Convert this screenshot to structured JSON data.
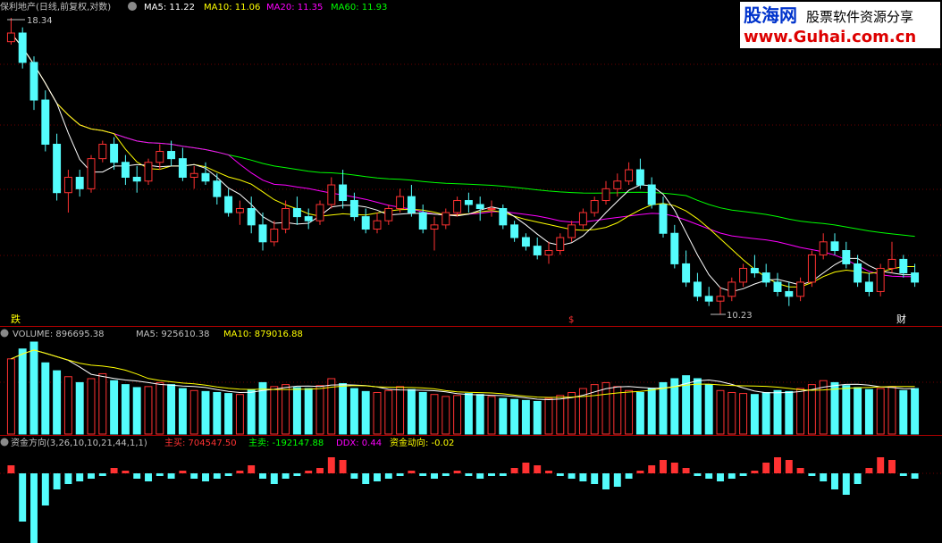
{
  "header": {
    "title": "保利地产(日线,前复权,对数)",
    "ma5": "MA5: 11.22",
    "ma10": "MA10: 11.06",
    "ma20": "MA20: 11.35",
    "ma60": "MA60: 11.93"
  },
  "price_panel": {
    "high_label": "18.34",
    "low_label": "10.23",
    "marker_left": "跌",
    "marker_mid": "$",
    "marker_right": "财"
  },
  "volume_panel": {
    "header": "VOLUME: 896695.38",
    "ma5": "MA5: 925610.38",
    "ma10": "MA10: 879016.88"
  },
  "fund_panel": {
    "title": "资金方向(3,26,10,10,21,44,1,1)",
    "main_buy": "主买: 704547.50",
    "main_sell": "主卖: -192147.88",
    "ddx": "DDX: 0.44",
    "flow": "资金动向: -0.02"
  },
  "logo": {
    "name": "股海网",
    "slogan": "股票软件资源分享",
    "url": "www.Guhai.com.cn"
  },
  "colors": {
    "up": "#ff3232",
    "down": "#54fcfc",
    "ma5": "#ffffff",
    "ma10": "#ffff00",
    "ma20": "#ff00ff",
    "ma60": "#00ff00",
    "background": "#000000",
    "grid": "#8b0000"
  },
  "chart_data": {
    "type": "candlestick",
    "title": "保利地产(日线,前复权,对数)",
    "y_high": 18.34,
    "y_low": 10.23,
    "ohlc": [
      [
        17.5,
        18.34,
        17.4,
        17.8
      ],
      [
        17.8,
        18.0,
        16.6,
        16.8
      ],
      [
        16.8,
        17.0,
        15.3,
        15.6
      ],
      [
        15.6,
        15.9,
        14.1,
        14.3
      ],
      [
        14.3,
        14.6,
        12.8,
        13.0
      ],
      [
        13.0,
        13.6,
        12.5,
        13.4
      ],
      [
        13.4,
        13.6,
        12.9,
        13.1
      ],
      [
        13.1,
        14.0,
        13.0,
        13.9
      ],
      [
        13.9,
        14.4,
        13.8,
        14.3
      ],
      [
        14.3,
        14.5,
        13.6,
        13.8
      ],
      [
        13.8,
        14.0,
        13.2,
        13.4
      ],
      [
        13.4,
        13.7,
        13.0,
        13.3
      ],
      [
        13.3,
        13.9,
        13.2,
        13.8
      ],
      [
        13.8,
        14.3,
        13.6,
        14.1
      ],
      [
        14.1,
        14.4,
        13.7,
        13.9
      ],
      [
        13.9,
        14.2,
        13.3,
        13.4
      ],
      [
        13.4,
        13.7,
        13.1,
        13.5
      ],
      [
        13.5,
        13.8,
        13.2,
        13.3
      ],
      [
        13.3,
        13.5,
        12.7,
        12.9
      ],
      [
        12.9,
        13.1,
        12.4,
        12.5
      ],
      [
        12.5,
        12.8,
        12.2,
        12.6
      ],
      [
        12.6,
        12.9,
        12.0,
        12.2
      ],
      [
        12.2,
        12.5,
        11.6,
        11.8
      ],
      [
        11.8,
        12.3,
        11.7,
        12.1
      ],
      [
        12.1,
        12.8,
        12.0,
        12.6
      ],
      [
        12.6,
        12.9,
        12.2,
        12.4
      ],
      [
        12.4,
        12.6,
        12.1,
        12.3
      ],
      [
        12.3,
        12.8,
        12.2,
        12.7
      ],
      [
        12.7,
        13.4,
        12.6,
        13.2
      ],
      [
        13.2,
        13.6,
        12.6,
        12.8
      ],
      [
        12.8,
        13.0,
        12.3,
        12.4
      ],
      [
        12.4,
        12.6,
        12.0,
        12.1
      ],
      [
        12.1,
        12.5,
        12.0,
        12.3
      ],
      [
        12.3,
        12.7,
        12.2,
        12.6
      ],
      [
        12.6,
        13.1,
        12.5,
        12.9
      ],
      [
        12.9,
        13.2,
        12.4,
        12.5
      ],
      [
        12.5,
        12.7,
        12.0,
        12.1
      ],
      [
        12.1,
        12.4,
        11.6,
        12.2
      ],
      [
        12.2,
        12.6,
        12.1,
        12.5
      ],
      [
        12.5,
        12.9,
        12.4,
        12.8
      ],
      [
        12.8,
        13.0,
        12.5,
        12.7
      ],
      [
        12.7,
        12.9,
        12.3,
        12.6
      ],
      [
        12.6,
        12.8,
        12.4,
        12.6
      ],
      [
        12.6,
        12.7,
        12.1,
        12.2
      ],
      [
        12.2,
        12.3,
        11.8,
        11.9
      ],
      [
        11.9,
        12.0,
        11.6,
        11.7
      ],
      [
        11.7,
        11.9,
        11.4,
        11.5
      ],
      [
        11.5,
        11.8,
        11.3,
        11.6
      ],
      [
        11.6,
        12.0,
        11.5,
        11.9
      ],
      [
        11.9,
        12.3,
        11.8,
        12.2
      ],
      [
        12.2,
        12.6,
        12.1,
        12.5
      ],
      [
        12.5,
        12.9,
        12.4,
        12.8
      ],
      [
        12.8,
        13.3,
        12.7,
        13.1
      ],
      [
        13.1,
        13.5,
        12.9,
        13.3
      ],
      [
        13.3,
        13.8,
        13.2,
        13.6
      ],
      [
        13.6,
        13.9,
        13.1,
        13.2
      ],
      [
        13.2,
        13.4,
        12.6,
        12.7
      ],
      [
        12.7,
        12.9,
        11.9,
        12.0
      ],
      [
        12.0,
        12.2,
        11.2,
        11.3
      ],
      [
        11.3,
        11.6,
        10.8,
        10.9
      ],
      [
        10.9,
        11.1,
        10.5,
        10.6
      ],
      [
        10.6,
        10.8,
        10.4,
        10.5
      ],
      [
        10.5,
        10.8,
        10.23,
        10.6
      ],
      [
        10.6,
        11.0,
        10.5,
        10.9
      ],
      [
        10.9,
        11.3,
        10.8,
        11.2
      ],
      [
        11.2,
        11.5,
        11.0,
        11.1
      ],
      [
        11.1,
        11.3,
        10.8,
        10.9
      ],
      [
        10.9,
        11.1,
        10.6,
        10.7
      ],
      [
        10.7,
        10.9,
        10.4,
        10.6
      ],
      [
        10.6,
        11.0,
        10.5,
        10.9
      ],
      [
        10.9,
        11.6,
        10.8,
        11.5
      ],
      [
        11.5,
        12.0,
        11.4,
        11.8
      ],
      [
        11.8,
        12.0,
        11.5,
        11.6
      ],
      [
        11.6,
        11.8,
        11.2,
        11.3
      ],
      [
        11.3,
        11.5,
        10.8,
        10.9
      ],
      [
        10.9,
        11.1,
        10.6,
        10.7
      ],
      [
        10.7,
        11.3,
        10.6,
        11.2
      ],
      [
        11.2,
        11.8,
        11.1,
        11.4
      ],
      [
        11.4,
        11.5,
        11.0,
        11.1
      ],
      [
        11.1,
        11.3,
        10.8,
        10.9
      ]
    ],
    "volume": [
      760,
      860,
      930,
      720,
      640,
      580,
      520,
      560,
      610,
      540,
      500,
      470,
      480,
      520,
      500,
      460,
      440,
      430,
      420,
      410,
      400,
      450,
      520,
      480,
      500,
      470,
      460,
      490,
      560,
      510,
      460,
      430,
      420,
      440,
      480,
      450,
      420,
      400,
      380,
      390,
      410,
      400,
      380,
      360,
      350,
      340,
      330,
      360,
      390,
      420,
      460,
      500,
      520,
      480,
      440,
      420,
      460,
      520,
      560,
      590,
      560,
      500,
      440,
      420,
      410,
      400,
      420,
      440,
      430,
      460,
      500,
      540,
      520,
      490,
      470,
      450,
      460,
      480,
      440,
      460
    ],
    "fund_flow": [
      0.3,
      -1.8,
      -2.6,
      -1.2,
      -0.6,
      -0.4,
      -0.3,
      -0.2,
      -0.1,
      0.2,
      0.1,
      -0.2,
      -0.3,
      -0.1,
      -0.2,
      0.1,
      -0.2,
      -0.3,
      -0.2,
      -0.1,
      0.1,
      0.3,
      -0.2,
      -0.4,
      -0.2,
      -0.1,
      0.1,
      0.2,
      0.6,
      0.5,
      -0.2,
      -0.4,
      -0.3,
      -0.2,
      -0.1,
      0.1,
      -0.1,
      -0.2,
      -0.1,
      0.1,
      -0.1,
      -0.2,
      -0.1,
      -0.1,
      0.2,
      0.4,
      0.3,
      0.1,
      -0.1,
      -0.2,
      -0.3,
      -0.4,
      -0.6,
      -0.5,
      -0.2,
      0.1,
      0.3,
      0.5,
      0.4,
      0.2,
      -0.1,
      -0.2,
      -0.3,
      -0.2,
      -0.1,
      0.1,
      0.4,
      0.6,
      0.5,
      0.2,
      -0.1,
      -0.3,
      -0.6,
      -0.8,
      -0.4,
      0.2,
      0.6,
      0.5,
      -0.1,
      -0.2
    ]
  }
}
